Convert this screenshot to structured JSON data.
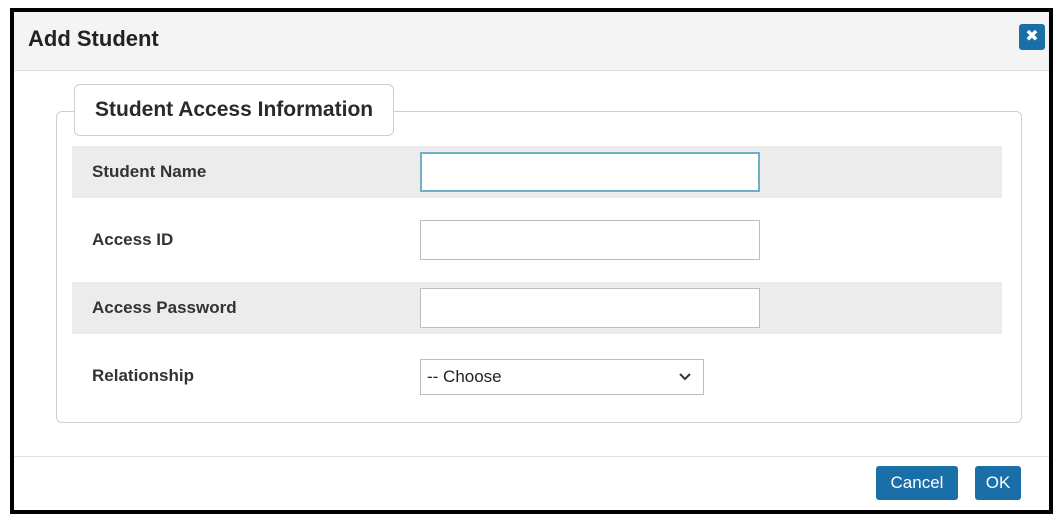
{
  "dialog": {
    "title": "Add Student",
    "close_icon": "close-icon"
  },
  "section": {
    "legend": "Student Access Information",
    "fields": {
      "student_name": {
        "label": "Student Name",
        "value": ""
      },
      "access_id": {
        "label": "Access ID",
        "value": ""
      },
      "access_password": {
        "label": "Access Password",
        "value": ""
      },
      "relationship": {
        "label": "Relationship",
        "selected": "-- Choose"
      }
    }
  },
  "footer": {
    "cancel_label": "Cancel",
    "ok_label": "OK"
  },
  "colors": {
    "button_blue": "#1b6fa8",
    "row_shade": "#ececec",
    "focus_border": "#6fb0c8"
  }
}
